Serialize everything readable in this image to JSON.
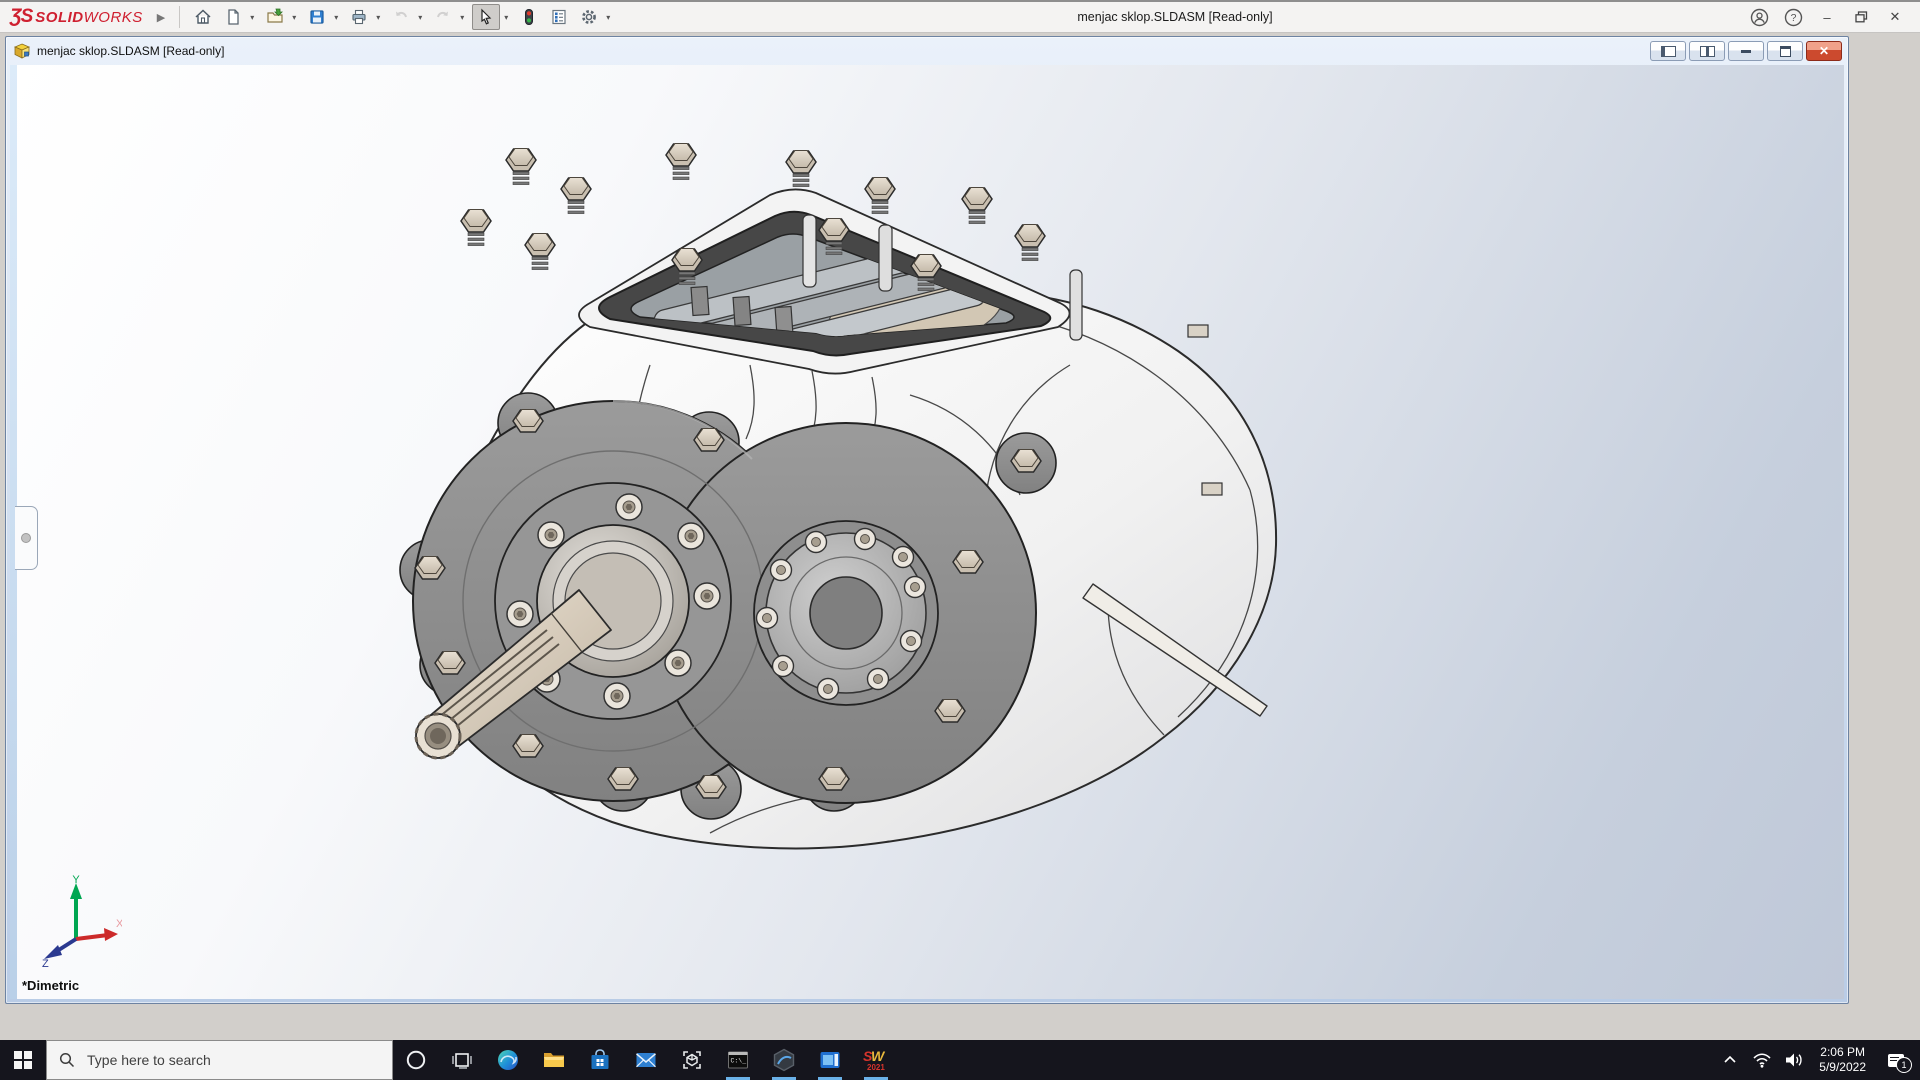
{
  "app": {
    "logo": {
      "mark": "ƷS",
      "solid": "SOLID",
      "works": "WORKS"
    },
    "window_title": "menjac sklop.SLDASM [Read-only]",
    "toolbar_icons": [
      "home",
      "new-document",
      "open",
      "save",
      "print",
      "undo",
      "redo",
      "select-cursor",
      "selection-lights",
      "file-properties",
      "options-gear"
    ],
    "right_icons": [
      "account",
      "help",
      "minimize",
      "restore",
      "close"
    ]
  },
  "doc": {
    "title": "menjac sklop.SLDASM [Read-only]",
    "view_label": "*Dimetric",
    "triad": {
      "x": "X",
      "y": "Y",
      "z": "Z"
    },
    "window_buttons": [
      "feature-pane-toggle",
      "task-pane-toggle",
      "minimize",
      "restore",
      "close"
    ]
  },
  "taskbar": {
    "search_placeholder": "Type here to search",
    "icons": [
      "start",
      "cortana",
      "task-view",
      "edge",
      "file-explorer",
      "store",
      "mail",
      "3d-viewer",
      "command-prompt",
      "hexagon-app",
      "media-app",
      "solidworks-2021"
    ],
    "running": [
      "command-prompt",
      "hexagon-app",
      "media-app",
      "solidworks-2021"
    ],
    "solidworks_year": "2021",
    "tray": {
      "icons": [
        "hidden-icons-chevron",
        "wifi",
        "volume",
        "clock",
        "action-center"
      ],
      "time": "2:06 PM",
      "date": "5/9/2022",
      "notification_count": "1"
    }
  },
  "colors": {
    "solidworks_red": "#cf2030",
    "titlebar_bg": "#f4f3f2",
    "doc_frame_top": "#eaf1fa",
    "doc_frame_bottom": "#b9cce6",
    "viewport_top": "#ffffff",
    "viewport_bottom": "#bfc8d8",
    "taskbar_bg": "#15151d",
    "running_indicator": "#6ab1e8",
    "triad_x": "#e05a5a",
    "triad_y": "#00a651",
    "triad_z": "#2b3990"
  }
}
